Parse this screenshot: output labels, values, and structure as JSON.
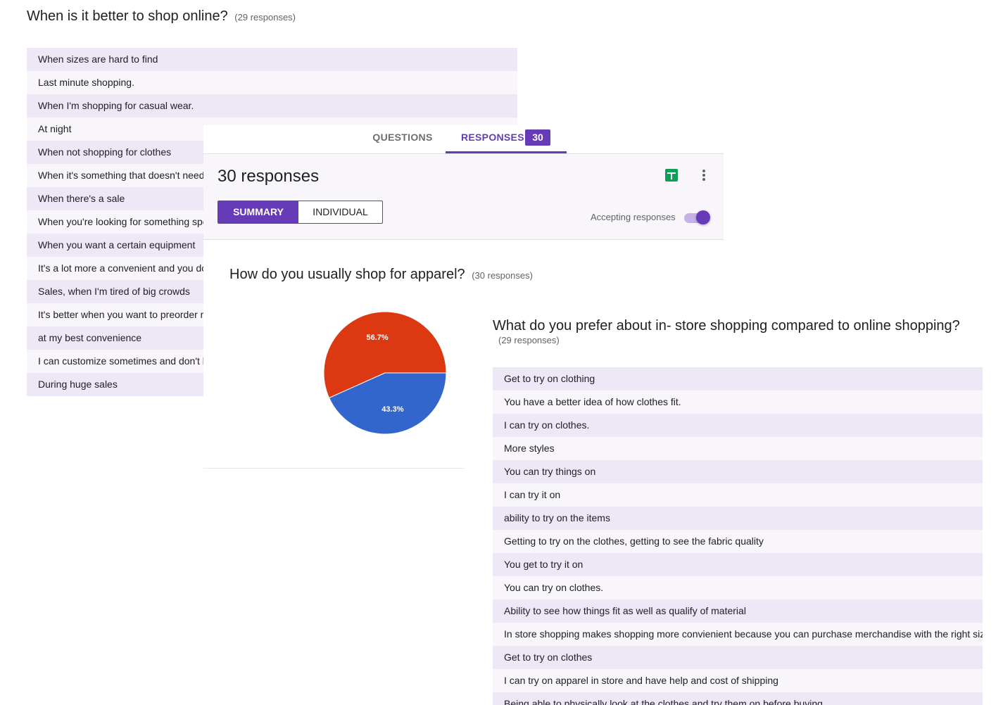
{
  "online_question": {
    "title": "When is it better to shop online?",
    "responses_count": "(29 responses)",
    "answers": [
      "When sizes are hard to find",
      "Last minute shopping.",
      "When I'm shopping for casual wear.",
      "At night",
      "When not shopping for clothes",
      "When it's something that doesn't need to",
      "When there's a sale",
      "When you're looking for something speci",
      "When you want a certain equipment",
      "It's a lot more a convenient and you don't",
      "Sales, when I'm tired of big crowds",
      "It's better when you want to preorder mer",
      "at my best convenience",
      "I can customize sometimes and don't hav",
      "During huge sales"
    ]
  },
  "tabs": {
    "questions_label": "QUESTIONS",
    "responses_label": "RESPONSES",
    "responses_badge": "30"
  },
  "summary_header": {
    "title": "30 responses",
    "summary_button": "SUMMARY",
    "individual_button": "INDIVIDUAL",
    "accepting_label": "Accepting responses",
    "accepting_on": true,
    "icons": [
      "sheets-icon",
      "more-vert-icon"
    ]
  },
  "apparel_question": {
    "title": "How do you usually shop for apparel?",
    "responses_count": "(30 responses)"
  },
  "chart_data": {
    "type": "pie",
    "slices": [
      {
        "value": 56.7,
        "label": "56.7%",
        "color": "#dc3912"
      },
      {
        "value": 43.3,
        "label": "43.3%",
        "color": "#3366cc"
      }
    ]
  },
  "instore_question": {
    "title": "What do you prefer about in- store shopping compared to online shopping?",
    "responses_count": "(29 responses)",
    "answers": [
      "Get to try on clothing",
      "You have a better idea of how clothes fit.",
      "I can try on clothes.",
      "More styles",
      "You can try things on",
      "I can try it on",
      "ability to try on the items",
      "Getting to try on the clothes, getting to see the fabric quality",
      "You get to try it on",
      "You can try on clothes.",
      "Ability to see how things fit as well as qualify of material",
      "In store shopping makes shopping more convienient because you can purchase merchandise with the right size.",
      "Get to try on clothes",
      "I can try on apparel in store and have help and cost of shipping",
      "Being able to physically look at the clothes and try them on before buying"
    ]
  },
  "colors": {
    "accent": "#673ab7",
    "row_odd": "#ede7f6",
    "row_even": "#f8f5fb"
  }
}
